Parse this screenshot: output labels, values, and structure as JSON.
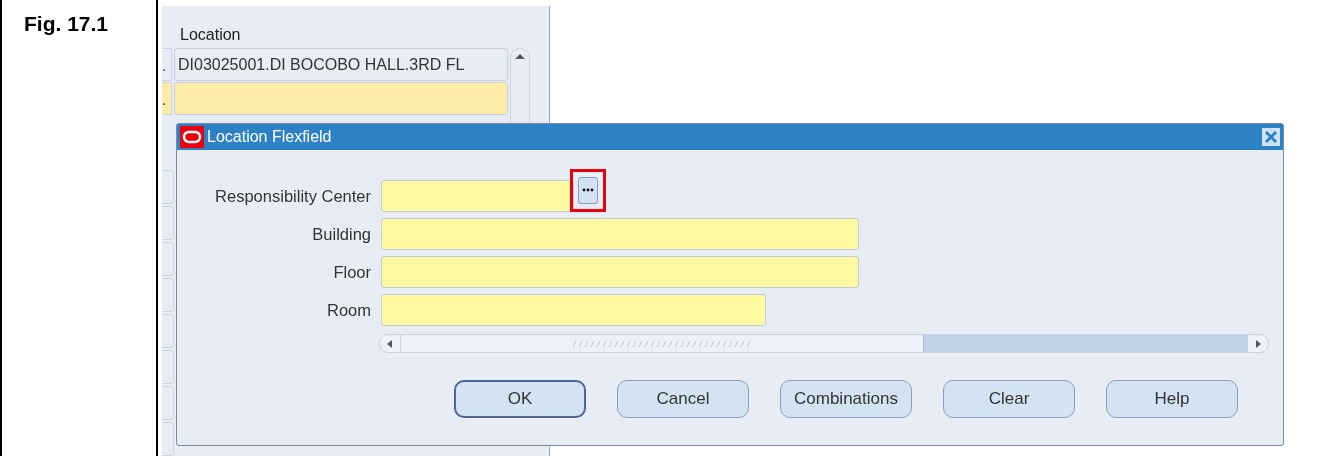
{
  "figure_label": "Fig. 17.1",
  "background_form": {
    "column_header": "Location",
    "rows": [
      {
        "prefix": ".",
        "value": "DI03025001.DI BOCOBO HALL.3RD FL",
        "selected": false
      },
      {
        "prefix": ".",
        "selected": true
      }
    ]
  },
  "dialog": {
    "title": "Location Flexfield",
    "fields": [
      {
        "label": "Responsibility Center",
        "kind": "lov",
        "highlighted": true
      },
      {
        "label": "Building",
        "kind": "wide"
      },
      {
        "label": "Floor",
        "kind": "wide"
      },
      {
        "label": "Room",
        "kind": "medium"
      }
    ],
    "buttons": [
      {
        "label": "OK",
        "default": true
      },
      {
        "label": "Cancel",
        "default": false
      },
      {
        "label": "Combinations",
        "default": false
      },
      {
        "label": "Clear",
        "default": false
      },
      {
        "label": "Help",
        "default": false
      }
    ]
  }
}
